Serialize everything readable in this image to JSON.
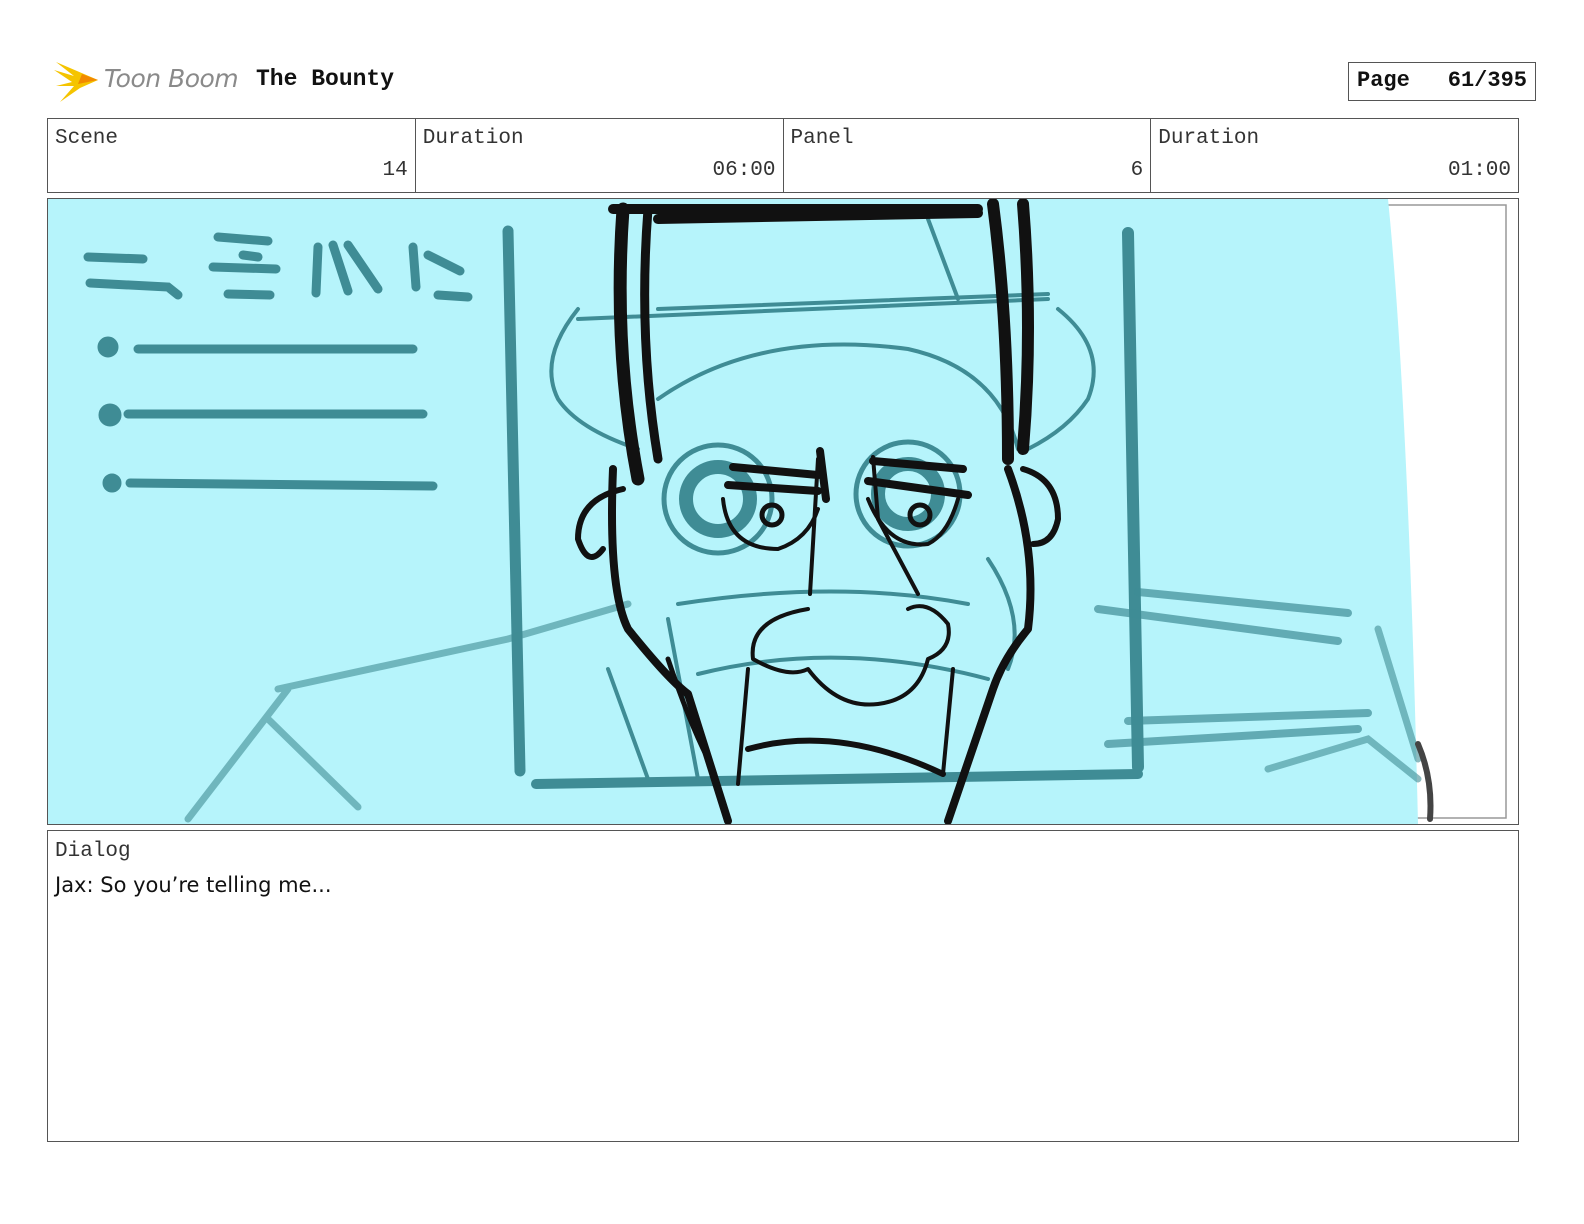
{
  "header": {
    "logo_text": "Toon Boom",
    "project_title": "The Bounty",
    "page_label": "Page",
    "page_value": "61/395"
  },
  "info": {
    "scene_label": "Scene",
    "scene_value": "14",
    "scene_duration_label": "Duration",
    "scene_duration_value": "06:00",
    "panel_label": "Panel",
    "panel_value": "6",
    "panel_duration_label": "Duration",
    "panel_duration_value": "01:00"
  },
  "dialog": {
    "label": "Dialog",
    "text": "Jax: So you’re telling me..."
  },
  "colors": {
    "panel_bg": "#b6f4fb",
    "sketch_teal": "#3f8c95",
    "ink": "#111111",
    "logo_yellow": "#f5c400"
  },
  "icons": {
    "logo": "toon-boom-burst-icon"
  }
}
